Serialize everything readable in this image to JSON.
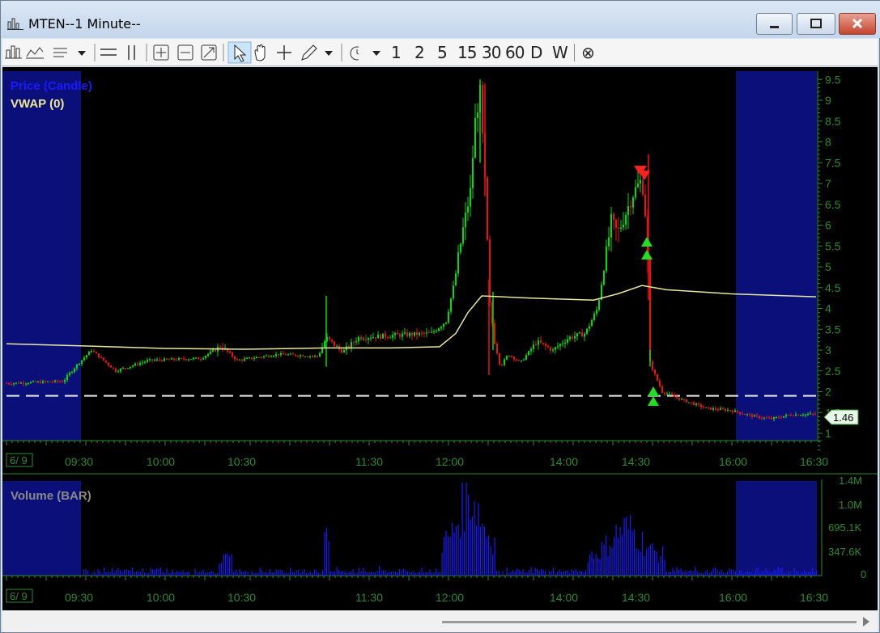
{
  "window": {
    "title": "MTEN--1 Minute--"
  },
  "toolbar": {
    "icons": [
      "bar-chart-icon",
      "line-chart-icon",
      "list-icon",
      "dropdown-icon",
      "horizontal-line-icon",
      "vertical-line-icon",
      "zoom-in-icon",
      "zoom-fit-icon",
      "zoom-box-icon",
      "pointer-icon",
      "hand-icon",
      "crosshair-icon",
      "pencil-icon",
      "dropdown-icon",
      "clock-icon",
      "dropdown-icon"
    ],
    "periods": [
      "1",
      "2",
      "5",
      "15",
      "30",
      "60",
      "D",
      "W"
    ],
    "close_symbol": "⊗"
  },
  "price_panel": {
    "legend_price": "Price (Candle)",
    "legend_vwap": "VWAP (0)",
    "price_axis_labels": [
      "9.5",
      "9",
      "8.5",
      "8",
      "7.5",
      "7",
      "6.5",
      "6",
      "5.5",
      "5",
      "4.5",
      "4",
      "3.5",
      "3",
      "2.5",
      "2",
      "1.5",
      "1"
    ],
    "last_price": "1.46",
    "dashed_level": 1.9
  },
  "volume_panel": {
    "legend": "Volume (BAR)",
    "axis_labels": [
      "1.4M",
      "1.0M",
      "695.1K",
      "347.6K",
      "0"
    ]
  },
  "time_axis": {
    "date_label": "6/ 9",
    "labels": [
      "09:30",
      "10:00",
      "10:30",
      "11:30",
      "12:00",
      "14:00",
      "14:30",
      "16:00",
      "16:30"
    ]
  },
  "colors": {
    "up": "#00dd00",
    "down": "#ee1111",
    "vwap": "#e8e8a0",
    "session_shade": "#0a0f7a",
    "axis": "#2e8b2e",
    "volume": "#1a1aff"
  }
}
